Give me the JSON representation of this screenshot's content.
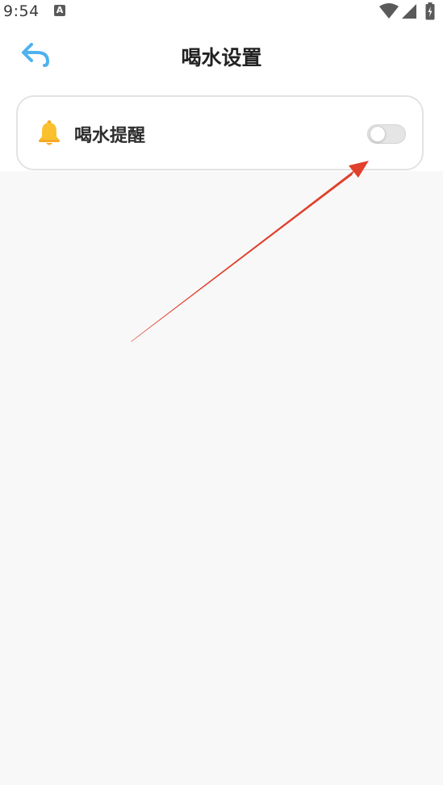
{
  "status_bar": {
    "time": "9:54",
    "notification_icon_letter": "A",
    "icons": [
      "wifi-icon",
      "signal-icon",
      "battery-icon"
    ]
  },
  "header": {
    "back_icon": "back-arrow-icon",
    "title": "喝水设置"
  },
  "reminder": {
    "icon": "bell-icon",
    "label": "喝水提醒",
    "enabled": false
  },
  "colors": {
    "accent_blue": "#4fb2ef",
    "bell_yellow": "#fbc02d",
    "annotation_red": "#e0402c",
    "background": "#f8f8f8"
  }
}
